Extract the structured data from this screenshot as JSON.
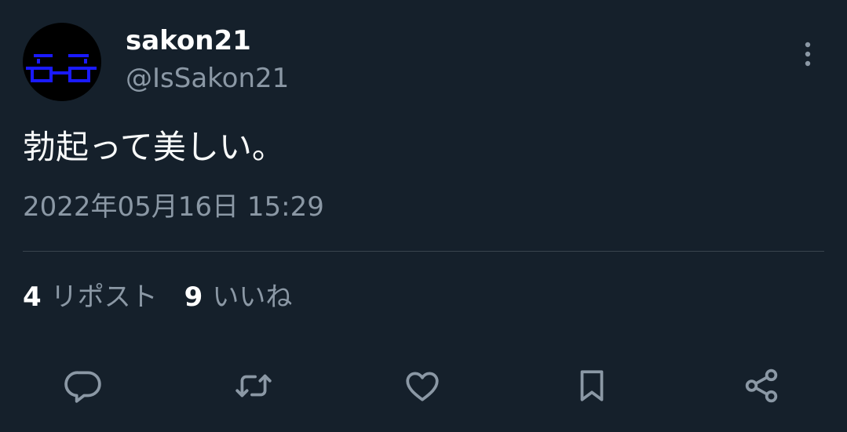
{
  "author": {
    "display_name": "sakon21",
    "handle": "@IsSakon21"
  },
  "tweet": {
    "text": "勃起って美しい。",
    "timestamp": "2022年05月16日 15:29"
  },
  "stats": {
    "reposts_count": "4",
    "reposts_label": "リポスト",
    "likes_count": "9",
    "likes_label": "いいね"
  },
  "colors": {
    "background": "#15202b",
    "secondary_text": "#8b98a5",
    "divider": "#38444d",
    "avatar_glasses": "#1a1aff"
  },
  "icons": {
    "more": "more-vertical-icon",
    "reply": "reply-icon",
    "repost": "repost-icon",
    "like": "heart-icon",
    "bookmark": "bookmark-icon",
    "share": "share-icon"
  }
}
